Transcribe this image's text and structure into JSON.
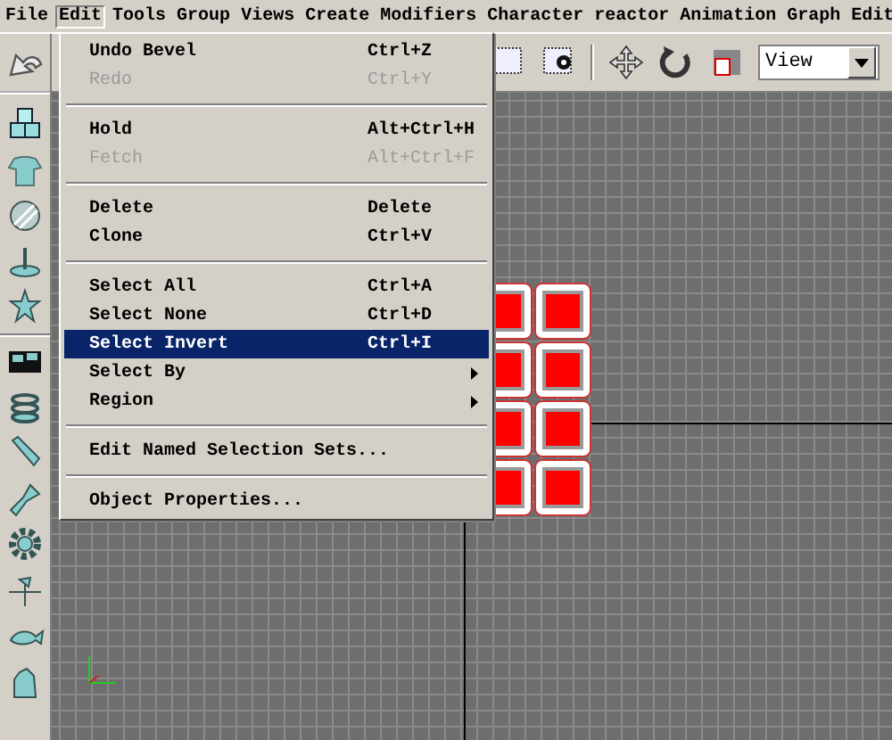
{
  "menubar": [
    {
      "label": "File",
      "selected": false
    },
    {
      "label": "Edit",
      "selected": true
    },
    {
      "label": "Tools",
      "selected": false
    },
    {
      "label": "Group",
      "selected": false
    },
    {
      "label": "Views",
      "selected": false
    },
    {
      "label": "Create",
      "selected": false
    },
    {
      "label": "Modifiers",
      "selected": false
    },
    {
      "label": "Character",
      "selected": false
    },
    {
      "label": "reactor",
      "selected": false
    },
    {
      "label": "Animation",
      "selected": false
    },
    {
      "label": "Graph Edit",
      "selected": false
    }
  ],
  "edit_menu": [
    {
      "kind": "item",
      "label": "Undo Bevel",
      "shortcut": "Ctrl+Z",
      "disabled": false,
      "selected": false,
      "submenu": false
    },
    {
      "kind": "item",
      "label": "Redo",
      "shortcut": "Ctrl+Y",
      "disabled": true,
      "selected": false,
      "submenu": false
    },
    {
      "kind": "separator"
    },
    {
      "kind": "item",
      "label": "Hold",
      "shortcut": "Alt+Ctrl+H",
      "disabled": false,
      "selected": false,
      "submenu": false
    },
    {
      "kind": "item",
      "label": "Fetch",
      "shortcut": "Alt+Ctrl+F",
      "disabled": true,
      "selected": false,
      "submenu": false
    },
    {
      "kind": "separator"
    },
    {
      "kind": "item",
      "label": "Delete",
      "shortcut": "Delete",
      "disabled": false,
      "selected": false,
      "submenu": false
    },
    {
      "kind": "item",
      "label": "Clone",
      "shortcut": "Ctrl+V",
      "disabled": false,
      "selected": false,
      "submenu": false
    },
    {
      "kind": "separator"
    },
    {
      "kind": "item",
      "label": "Select All",
      "shortcut": "Ctrl+A",
      "disabled": false,
      "selected": false,
      "submenu": false
    },
    {
      "kind": "item",
      "label": "Select None",
      "shortcut": "Ctrl+D",
      "disabled": false,
      "selected": false,
      "submenu": false
    },
    {
      "kind": "item",
      "label": "Select Invert",
      "shortcut": "Ctrl+I",
      "disabled": false,
      "selected": true,
      "submenu": false
    },
    {
      "kind": "item",
      "label": "Select By",
      "disabled": false,
      "selected": false,
      "submenu": true
    },
    {
      "kind": "item",
      "label": "Region",
      "disabled": false,
      "selected": false,
      "submenu": true
    },
    {
      "kind": "separator"
    },
    {
      "kind": "item",
      "label": "Edit Named Selection Sets...",
      "disabled": false,
      "selected": false,
      "submenu": false
    },
    {
      "kind": "separator"
    },
    {
      "kind": "item",
      "label": "Object Properties...",
      "disabled": false,
      "selected": false,
      "submenu": false
    }
  ],
  "toolbar": {
    "view_dropdown": {
      "value": "View"
    }
  }
}
